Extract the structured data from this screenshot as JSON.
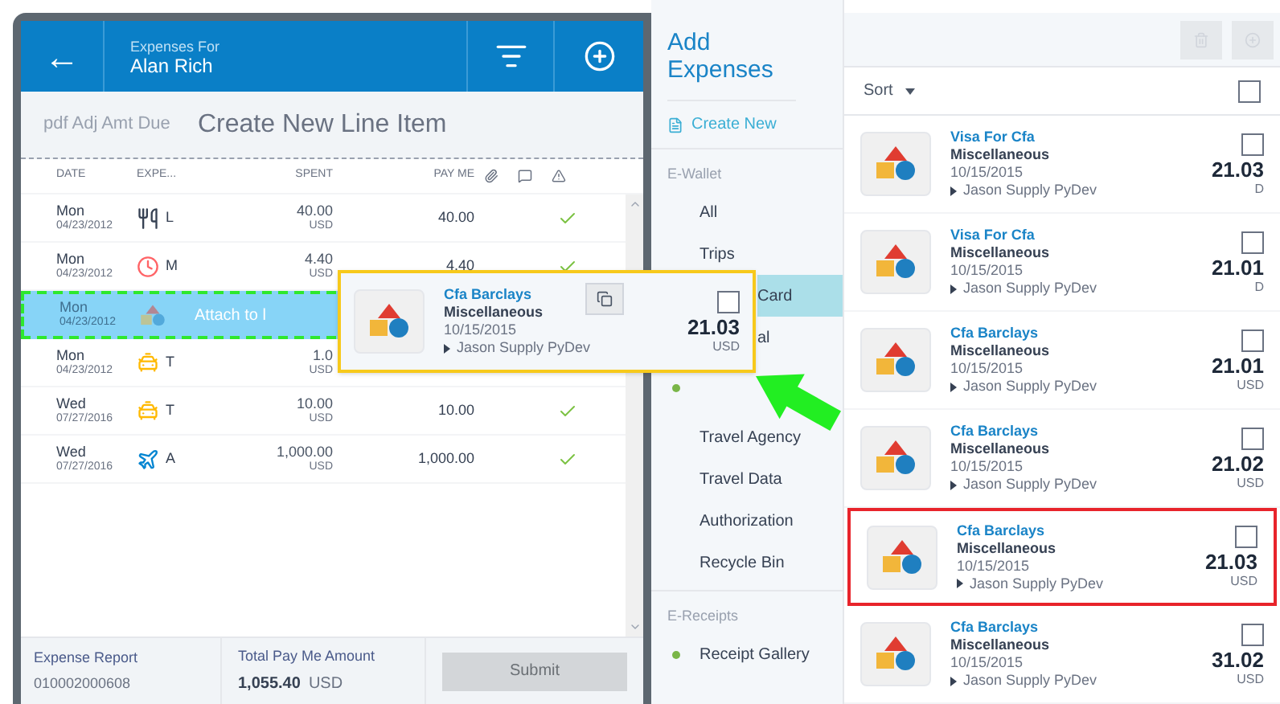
{
  "header": {
    "back": "←",
    "subtitle": "Expenses For",
    "title": "Alan Rich"
  },
  "create_band": {
    "background_text": "pdf Adj Amt Due",
    "label": "Create New Line Item"
  },
  "table": {
    "columns": [
      "DATE",
      "EXPE...",
      "SPENT",
      "PAY ME"
    ],
    "rows": [
      {
        "day": "Mon",
        "date": "04/23/2012",
        "kind": "meal",
        "letter": "L",
        "spent": "40.00",
        "currency": "USD",
        "pay_me": "40.00",
        "approved": true,
        "selected": false
      },
      {
        "day": "Mon",
        "date": "04/23/2012",
        "kind": "clock",
        "letter": "M",
        "spent": "4.40",
        "currency": "USD",
        "pay_me": "4.40",
        "approved": true,
        "selected": false
      },
      {
        "day": "Mon",
        "date": "04/23/2012",
        "kind": "shapes",
        "drop_label": "Attach to l",
        "selected": true
      },
      {
        "day": "Mon",
        "date": "04/23/2012",
        "kind": "taxi",
        "letter": "T",
        "spent": "1.0",
        "currency": "USD",
        "selected": false
      },
      {
        "day": "Wed",
        "date": "07/27/2016",
        "kind": "taxi",
        "letter": "T",
        "spent": "10.00",
        "currency": "USD",
        "pay_me": "10.00",
        "approved": true,
        "selected": false
      },
      {
        "day": "Wed",
        "date": "07/27/2016",
        "kind": "plane",
        "letter": "A",
        "spent": "1,000.00",
        "currency": "USD",
        "pay_me": "1,000.00",
        "approved": true,
        "selected": false
      }
    ]
  },
  "footer": {
    "report_label": "Expense Report",
    "report_number": "010002000608",
    "total_label": "Total Pay Me Amount",
    "total": "1,055.40",
    "total_currency": "USD",
    "submit": {
      "label": "Submit",
      "disabled": true
    }
  },
  "dragged_card": {
    "vendor": "Cfa Barclays",
    "category": "Miscellaneous",
    "date": "10/15/2015",
    "merchant": "Jason Supply PyDev",
    "amount": "21.03",
    "currency": "USD",
    "checked": false
  },
  "nav": {
    "title": "Add Expenses",
    "create": "Create New",
    "sections": [
      {
        "title": "E-Wallet",
        "items": [
          {
            "label": "All",
            "kind": "plain",
            "dot": false,
            "selected": false
          },
          {
            "label": "Trips",
            "kind": "plain",
            "dot": false,
            "selected": false
          },
          {
            "label": "Card",
            "kind": "clipped",
            "dot": false,
            "selected": true
          },
          {
            "label": "al",
            "kind": "clipped",
            "dot": false,
            "selected": false
          },
          {
            "kind": "marker",
            "dot": true,
            "selected": false
          },
          {
            "label": "Travel Agency",
            "kind": "plain",
            "dot": false,
            "selected": false
          },
          {
            "label": "Travel Data",
            "kind": "plain",
            "dot": false,
            "selected": false
          },
          {
            "label": "Authorization",
            "kind": "plain",
            "dot": false,
            "selected": false
          },
          {
            "label": "Recycle Bin",
            "kind": "plain",
            "dot": false,
            "selected": false
          }
        ]
      },
      {
        "title": "E-Receipts",
        "items": [
          {
            "label": "Receipt Gallery",
            "kind": "plain",
            "dot": true,
            "selected": false
          }
        ]
      }
    ]
  },
  "list": {
    "sort": "Sort",
    "all_checked": false,
    "items": [
      {
        "vendor": "Visa For Cfa",
        "category": "Miscellaneous",
        "date": "10/15/2015",
        "merchant": "Jason Supply PyDev",
        "amount": "21.03",
        "currency": "D",
        "checked": false,
        "highlighted": false
      },
      {
        "vendor": "Visa For Cfa",
        "category": "Miscellaneous",
        "date": "10/15/2015",
        "merchant": "Jason Supply PyDev",
        "amount": "21.01",
        "currency": "D",
        "checked": false,
        "highlighted": false
      },
      {
        "vendor": "Cfa Barclays",
        "category": "Miscellaneous",
        "date": "10/15/2015",
        "merchant": "Jason Supply PyDev",
        "amount": "21.01",
        "currency": "USD",
        "checked": false,
        "highlighted": false
      },
      {
        "vendor": "Cfa Barclays",
        "category": "Miscellaneous",
        "date": "10/15/2015",
        "merchant": "Jason Supply PyDev",
        "amount": "21.02",
        "currency": "USD",
        "checked": false,
        "highlighted": false
      },
      {
        "vendor": "Cfa Barclays",
        "category": "Miscellaneous",
        "date": "10/15/2015",
        "merchant": "Jason Supply PyDev",
        "amount": "21.03",
        "currency": "USD",
        "checked": false,
        "highlighted": true
      },
      {
        "vendor": "Cfa Barclays",
        "category": "Miscellaneous",
        "date": "10/15/2015",
        "merchant": "Jason Supply PyDev",
        "amount": "31.02",
        "currency": "USD",
        "checked": false,
        "highlighted": false
      }
    ]
  }
}
